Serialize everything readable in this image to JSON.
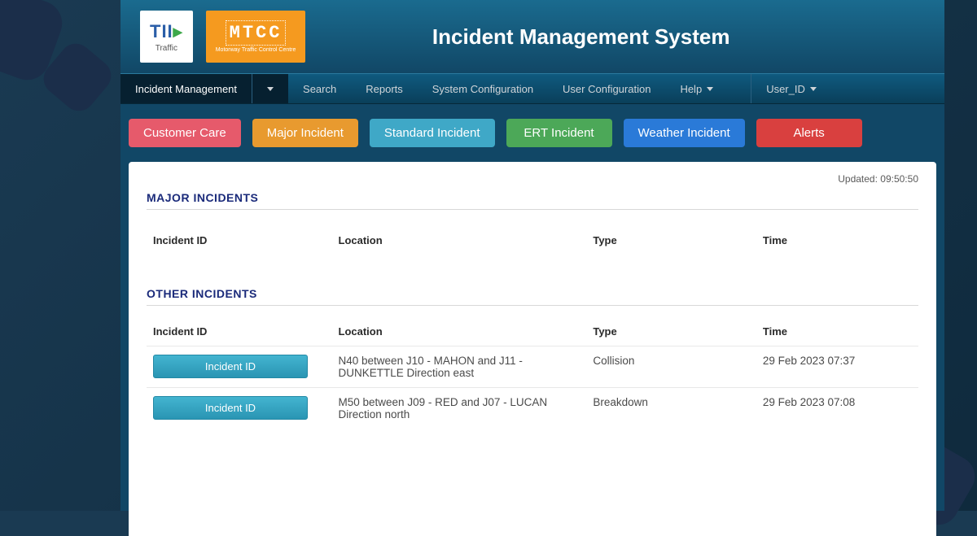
{
  "header": {
    "title": "Incident Management System",
    "logo1_main": "TII",
    "logo1_sub": "Traffic",
    "logo2_main": "MTCC",
    "logo2_sub": "Motorway Traffic Control Centre"
  },
  "nav": {
    "items": [
      "Incident Management",
      "Search",
      "Reports",
      "System Configuration",
      "User Configuration",
      "Help"
    ],
    "user": "User_ID"
  },
  "actions": {
    "customer_care": "Customer Care",
    "major_incident": "Major Incident",
    "standard_incident": "Standard Incident",
    "ert_incident": "ERT Incident",
    "weather_incident": "Weather Incident",
    "alerts": "Alerts"
  },
  "panel": {
    "updated_label": "Updated:",
    "updated_time": "09:50:50",
    "major_title": "MAJOR INCIDENTS",
    "other_title": "OTHER INCIDENTS",
    "columns": {
      "incident_id": "Incident ID",
      "location": "Location",
      "type": "Type",
      "time": "Time"
    },
    "id_button_label": "Incident ID",
    "other_rows": [
      {
        "location": "N40 between J10 - MAHON and J11 - DUNKETTLE Direction east",
        "type": "Collision",
        "time": "29 Feb 2023 07:37"
      },
      {
        "location": "M50 between J09 - RED and J07 - LUCAN Direction north",
        "type": "Breakdown",
        "time": "29 Feb 2023 07:08"
      }
    ]
  }
}
